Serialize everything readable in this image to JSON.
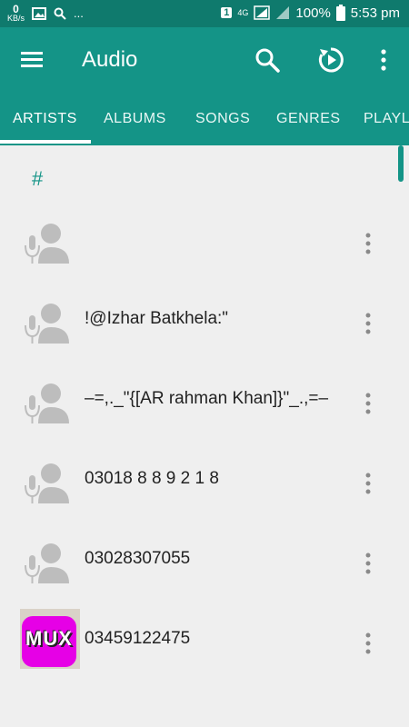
{
  "statusbar": {
    "data_speed_value": "0",
    "data_speed_unit": "KB/s",
    "overflow": "...",
    "sim_badge": "1",
    "network": "4G",
    "battery": "100%",
    "time": "5:53 pm"
  },
  "appbar": {
    "title": "Audio",
    "tabs": [
      "ARTISTS",
      "ALBUMS",
      "SONGS",
      "GENRES",
      "PLAYL"
    ]
  },
  "section": {
    "letter": "#"
  },
  "artists": [
    {
      "name": "",
      "avatar": "person-mic-icon"
    },
    {
      "name": "!@Izhar Batkhela:\"",
      "avatar": "person-mic-icon"
    },
    {
      "name": "–=,._\"{[AR rahman Khan]}\"_.,=–",
      "avatar": "person-mic-icon"
    },
    {
      "name": "03018 8 8 9 2 1 8",
      "avatar": "person-mic-icon"
    },
    {
      "name": "03028307055",
      "avatar": "person-mic-icon"
    },
    {
      "name": "03459122475",
      "avatar": "mux-thumbnail",
      "thumb_text": "MUX"
    }
  ],
  "colors": {
    "primary": "#149487",
    "primary_dark": "#0f7a6d",
    "background": "#efefef",
    "mux_magenta": "#e600e6"
  }
}
